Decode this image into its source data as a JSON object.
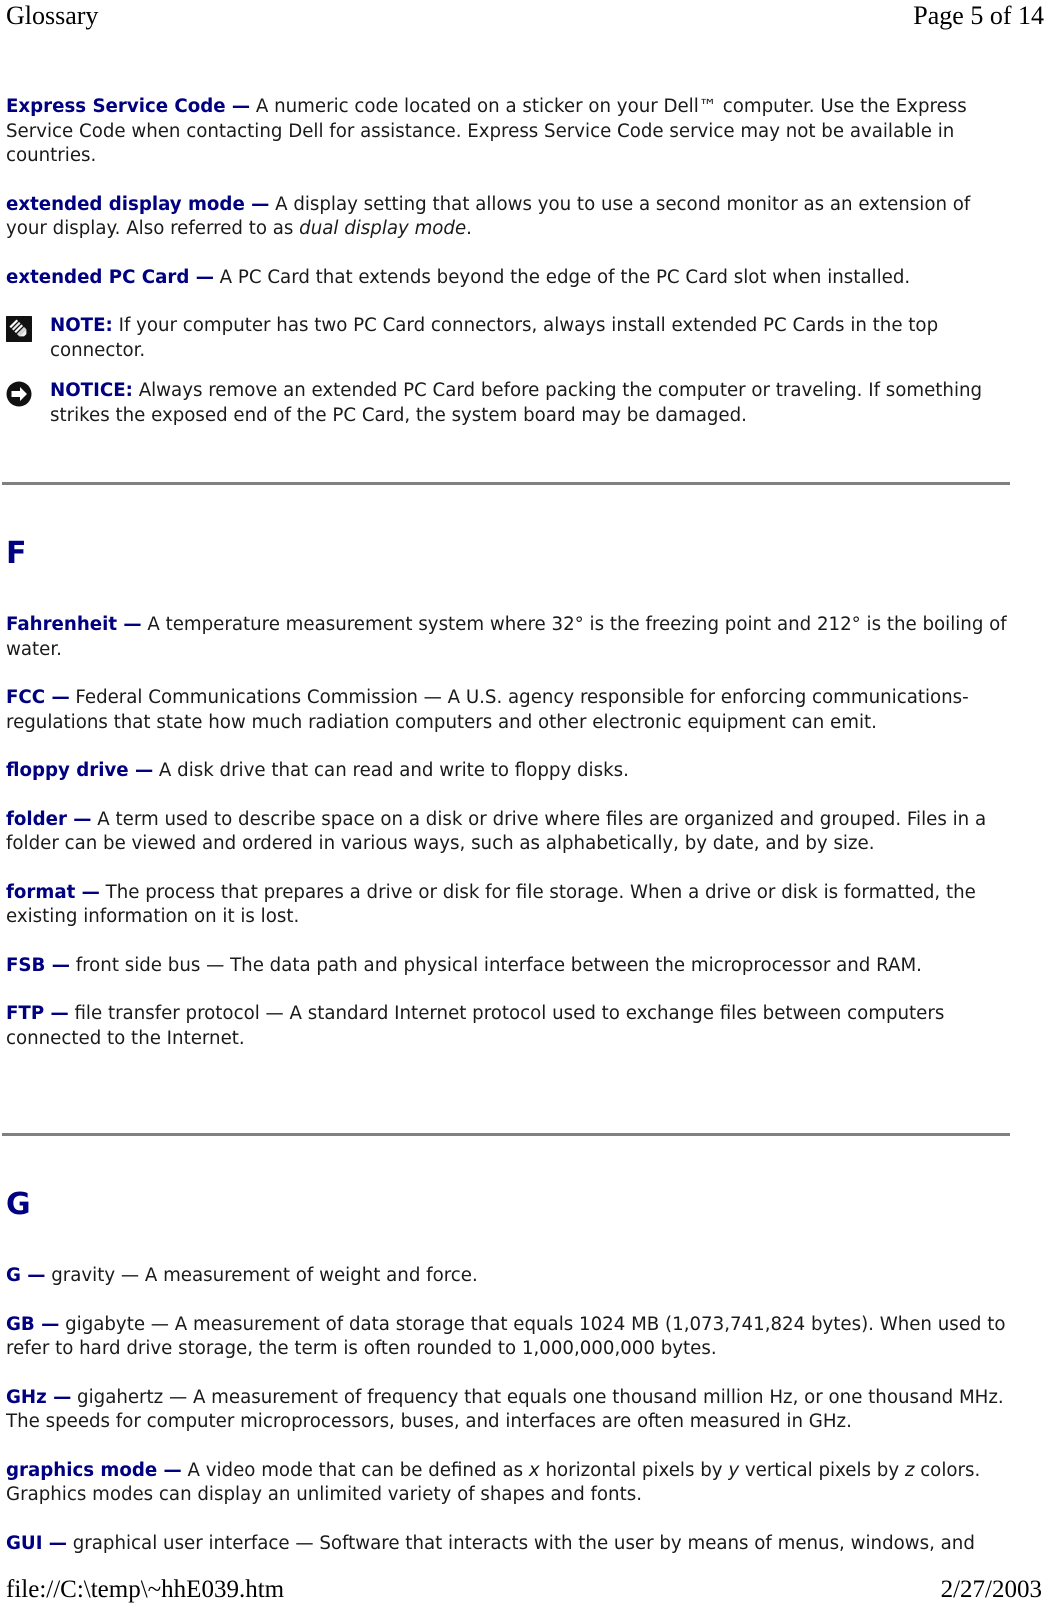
{
  "header": {
    "title": "Glossary",
    "page_label": "Page 5 of 14"
  },
  "footer": {
    "file_path": "file://C:\\temp\\~hhE039.htm",
    "date": "2/27/2003"
  },
  "colors": {
    "term_blue": "#000080",
    "rule_gray": "#808080",
    "body_text": "#1a1a1a",
    "page_background": "#ffffff"
  },
  "entries_before_f": [
    {
      "term": "Express Service Code —",
      "definition": " A numeric code located on a sticker on your Dell™ computer. Use the Express Service Code when contacting Dell for assistance. Express Service Code service may not be available in countries."
    },
    {
      "term": "extended display mode —",
      "definition_pre": " A display setting that allows you to use a second monitor as an extension of your display. Also referred to as ",
      "definition_italic": "dual display mode",
      "definition_post": "."
    },
    {
      "term": "extended PC Card —",
      "definition": " A PC Card that extends beyond the edge of the PC Card slot when installed."
    }
  ],
  "callouts": [
    {
      "icon": "note-pencil-icon",
      "label": "NOTE:",
      "text": " If your computer has two PC Card connectors, always install extended PC Cards in the top connector."
    },
    {
      "icon": "notice-arrow-icon",
      "label": "NOTICE:",
      "text": " Always remove an extended PC Card before packing the computer or traveling. If something strikes the exposed end of the PC Card, the system board may be damaged."
    }
  ],
  "section_f": {
    "letter": "F",
    "entries": [
      {
        "term": "Fahrenheit —",
        "definition": " A temperature measurement system where 32° is the freezing point and 212° is the boiling of water."
      },
      {
        "term": "FCC —",
        "definition": " Federal Communications Commission — A U.S. agency responsible for enforcing communications-regulations that state how much radiation computers and other electronic equipment can emit."
      },
      {
        "term": "floppy drive —",
        "definition": " A disk drive that can read and write to floppy disks."
      },
      {
        "term": "folder —",
        "definition": " A term used to describe space on a disk or drive where files are organized and grouped. Files in a folder can be viewed and ordered in various ways, such as alphabetically, by date, and by size."
      },
      {
        "term": "format —",
        "definition": " The process that prepares a drive or disk for file storage. When a drive or disk is formatted, the existing information on it is lost."
      },
      {
        "term": "FSB —",
        "definition": " front side bus — The data path and physical interface between the microprocessor and RAM."
      },
      {
        "term": "FTP —",
        "definition": " file transfer protocol — A standard Internet protocol used to exchange files between computers connected to the Internet."
      }
    ]
  },
  "section_g": {
    "letter": "G",
    "entries": [
      {
        "term": "G —",
        "definition": " gravity — A measurement of weight and force."
      },
      {
        "term": "GB —",
        "definition": " gigabyte — A measurement of data storage that equals 1024 MB (1,073,741,824 bytes). When used to refer to hard drive storage, the term is often rounded to 1,000,000,000 bytes."
      },
      {
        "term": "GHz —",
        "definition": " gigahertz — A measurement of frequency that equals one thousand million Hz, or one thousand MHz. The speeds for computer microprocessors, buses, and interfaces are often measured in GHz."
      },
      {
        "term": "graphics mode —",
        "graphics_mode": {
          "p1": " A video mode that can be defined as ",
          "x": "x",
          "p2": " horizontal pixels by ",
          "y": "y",
          "p3": " vertical pixels by ",
          "z": "z",
          "p4": " colors. Graphics modes can display an unlimited variety of shapes and fonts."
        }
      },
      {
        "term": "GUI —",
        "definition": " graphical user interface — Software that interacts with the user by means of menus, windows, and"
      }
    ]
  }
}
